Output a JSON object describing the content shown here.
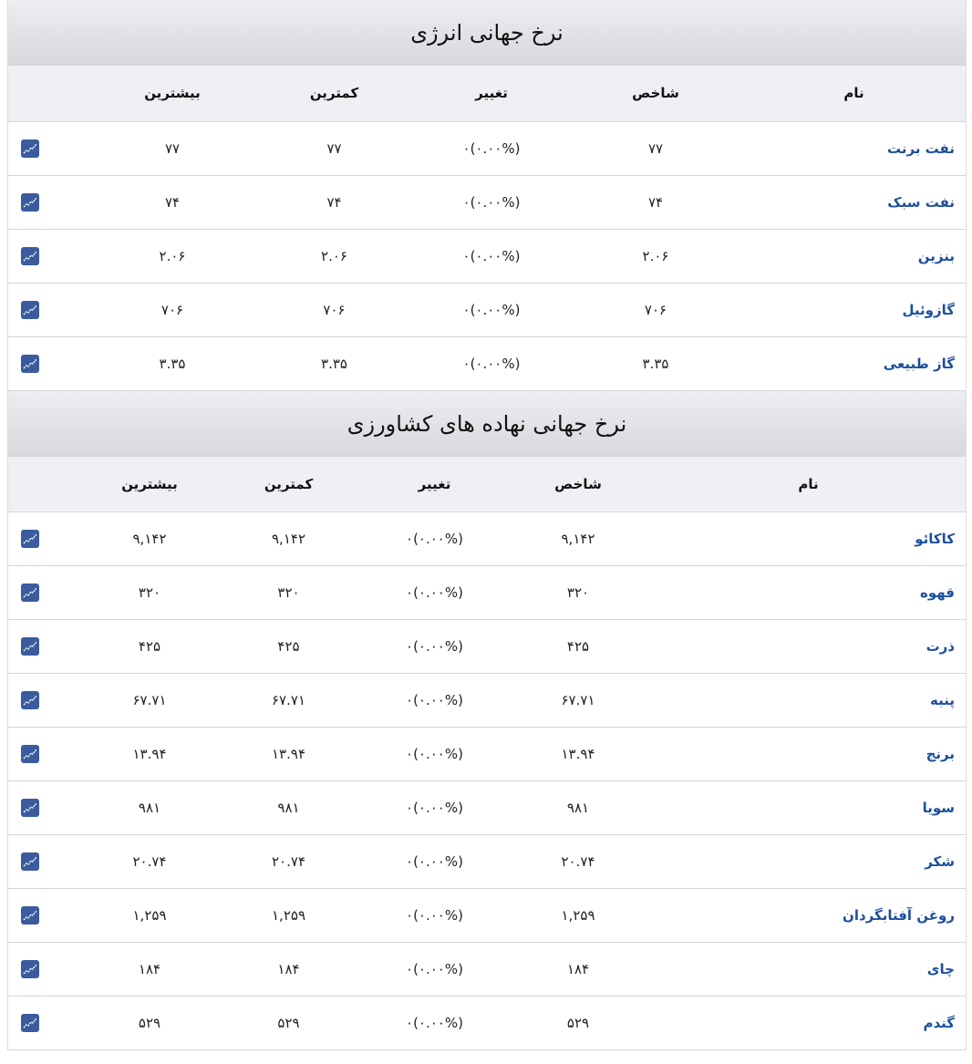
{
  "energy": {
    "title": "نرخ جهانی انرژی",
    "headers": {
      "name": "نام",
      "index": "شاخص",
      "change": "تغییر",
      "min": "کمترین",
      "max": "بیشترین"
    },
    "rows": [
      {
        "name": "نفت برنت",
        "index": "۷۷",
        "change": "۰(۰.۰۰%)",
        "min": "۷۷",
        "max": "۷۷",
        "icon": "chart-icon"
      },
      {
        "name": "نفت سبک",
        "index": "۷۴",
        "change": "۰(۰.۰۰%)",
        "min": "۷۴",
        "max": "۷۴",
        "icon": "chart-icon"
      },
      {
        "name": "بنزین",
        "index": "۲.۰۶",
        "change": "۰(۰.۰۰%)",
        "min": "۲.۰۶",
        "max": "۲.۰۶",
        "icon": "chart-icon"
      },
      {
        "name": "گازوئیل",
        "index": "۷۰۶",
        "change": "۰(۰.۰۰%)",
        "min": "۷۰۶",
        "max": "۷۰۶",
        "icon": "chart-icon"
      },
      {
        "name": "گاز طبیعی",
        "index": "۳.۳۵",
        "change": "۰(۰.۰۰%)",
        "min": "۳.۳۵",
        "max": "۳.۳۵",
        "icon": "chart-icon"
      }
    ]
  },
  "agriculture": {
    "title": "نرخ جهانی نهاده های کشاورزی",
    "headers": {
      "name": "نام",
      "index": "شاخص",
      "change": "تغییر",
      "min": "کمترین",
      "max": "بیشترین"
    },
    "rows": [
      {
        "name": "کاکائو",
        "index": "۹,۱۴۲",
        "change": "۰(۰.۰۰%)",
        "min": "۹,۱۴۲",
        "max": "۹,۱۴۲",
        "icon": "chart-icon"
      },
      {
        "name": "قهوه",
        "index": "۳۲۰",
        "change": "۰(۰.۰۰%)",
        "min": "۳۲۰",
        "max": "۳۲۰",
        "icon": "chart-icon"
      },
      {
        "name": "ذرت",
        "index": "۴۲۵",
        "change": "۰(۰.۰۰%)",
        "min": "۴۲۵",
        "max": "۴۲۵",
        "icon": "chart-icon"
      },
      {
        "name": "پنبه",
        "index": "۶۷.۷۱",
        "change": "۰(۰.۰۰%)",
        "min": "۶۷.۷۱",
        "max": "۶۷.۷۱",
        "icon": "chart-icon"
      },
      {
        "name": "برنج",
        "index": "۱۳.۹۴",
        "change": "۰(۰.۰۰%)",
        "min": "۱۳.۹۴",
        "max": "۱۳.۹۴",
        "icon": "chart-icon"
      },
      {
        "name": "سویا",
        "index": "۹۸۱",
        "change": "۰(۰.۰۰%)",
        "min": "۹۸۱",
        "max": "۹۸۱",
        "icon": "chart-icon"
      },
      {
        "name": "شکر",
        "index": "۲۰.۷۴",
        "change": "۰(۰.۰۰%)",
        "min": "۲۰.۷۴",
        "max": "۲۰.۷۴",
        "icon": "chart-icon"
      },
      {
        "name": "روغن آفتابگردان",
        "index": "۱,۲۵۹",
        "change": "۰(۰.۰۰%)",
        "min": "۱,۲۵۹",
        "max": "۱,۲۵۹",
        "icon": "chart-icon"
      },
      {
        "name": "چای",
        "index": "۱۸۴",
        "change": "۰(۰.۰۰%)",
        "min": "۱۸۴",
        "max": "۱۸۴",
        "icon": "chart-icon"
      },
      {
        "name": "گندم",
        "index": "۵۲۹",
        "change": "۰(۰.۰۰%)",
        "min": "۵۲۹",
        "max": "۵۲۹",
        "icon": "chart-icon"
      }
    ]
  },
  "colors": {
    "name_link": "#1c4f9c",
    "icon_bg": "#3b5b9e",
    "header_bg": "#eef0f4"
  }
}
